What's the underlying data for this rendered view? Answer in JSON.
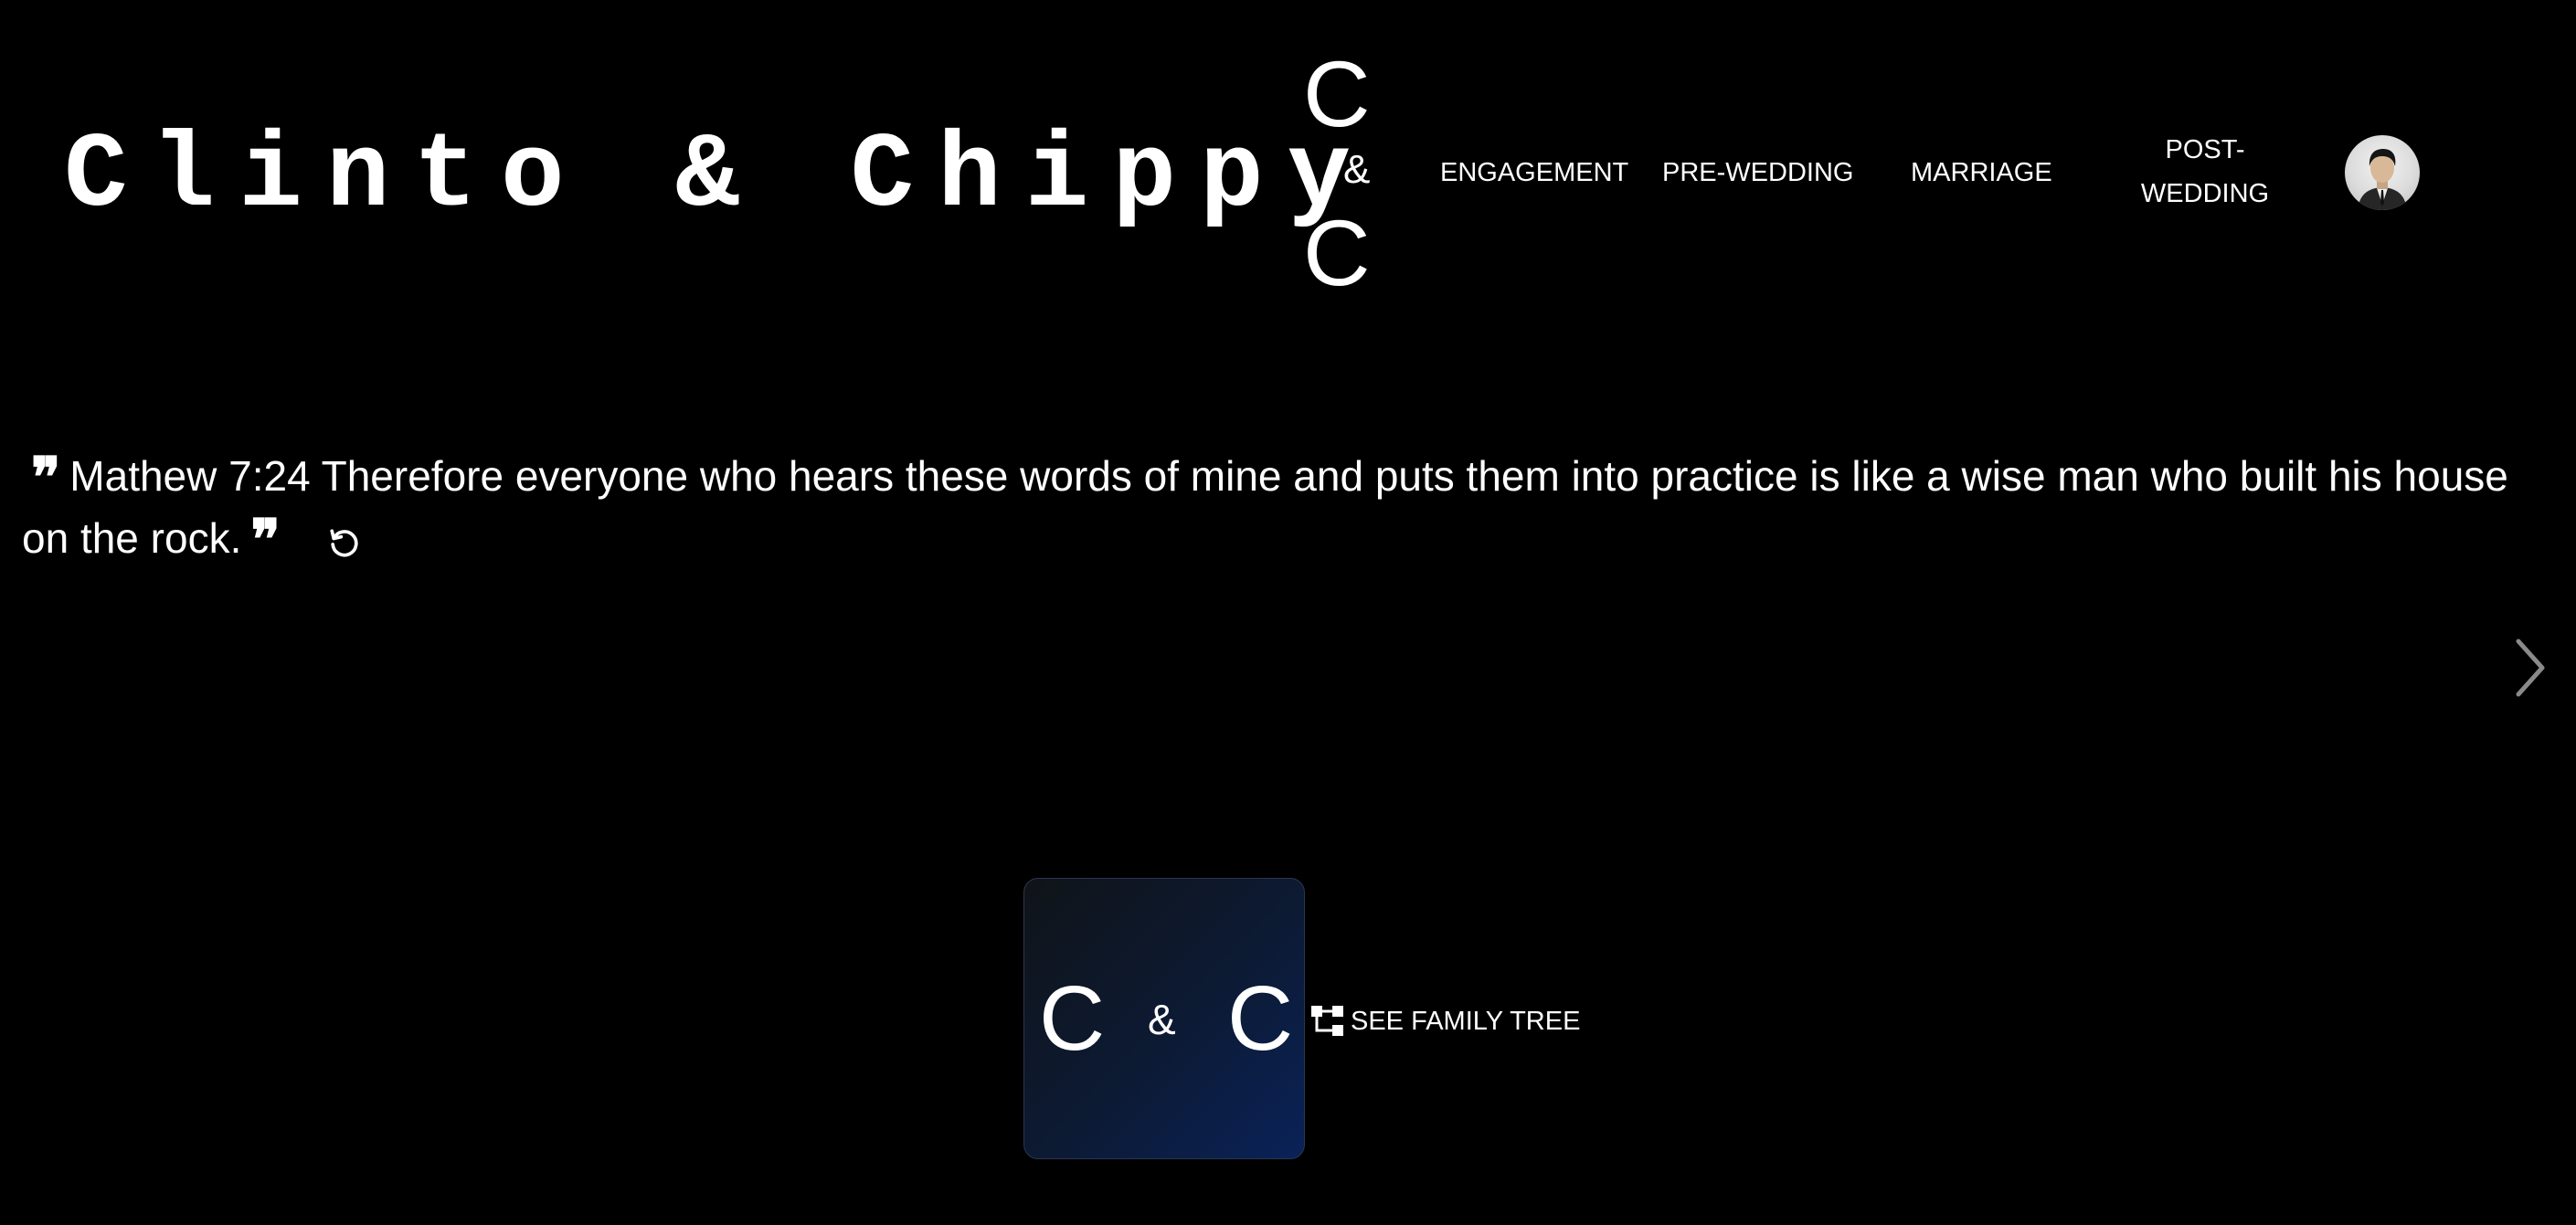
{
  "header": {
    "site_title": "Clinto & Chippy",
    "monogram": {
      "first": "C",
      "amp": "&",
      "second": "C"
    },
    "nav": {
      "engagement": "ENGAGEMENT",
      "pre_wedding": "PRE-WEDDING",
      "marriage": "MARRIAGE",
      "post_wedding": "POST-WEDDING"
    },
    "avatar_icon": "profile-photo"
  },
  "quote": {
    "open_mark": "❞",
    "text": "Mathew 7:24 Therefore everyone who hears these words of mine and puts them into practice is like a wise man who built his house on the rock.",
    "close_mark": "❞",
    "refresh_icon": "refresh-icon"
  },
  "carousel": {
    "next_icon": "chevron-right-icon"
  },
  "family_tree": {
    "monogram": {
      "first": "C",
      "amp": "&",
      "second": "C"
    },
    "icon": "family-tree-icon",
    "label": "SEE FAMILY TREE"
  },
  "colors": {
    "background": "#000000",
    "text": "#ffffff",
    "card_gradient_start": "#101418",
    "card_gradient_end": "#0a2258",
    "arrow": "#8a8a8a"
  }
}
